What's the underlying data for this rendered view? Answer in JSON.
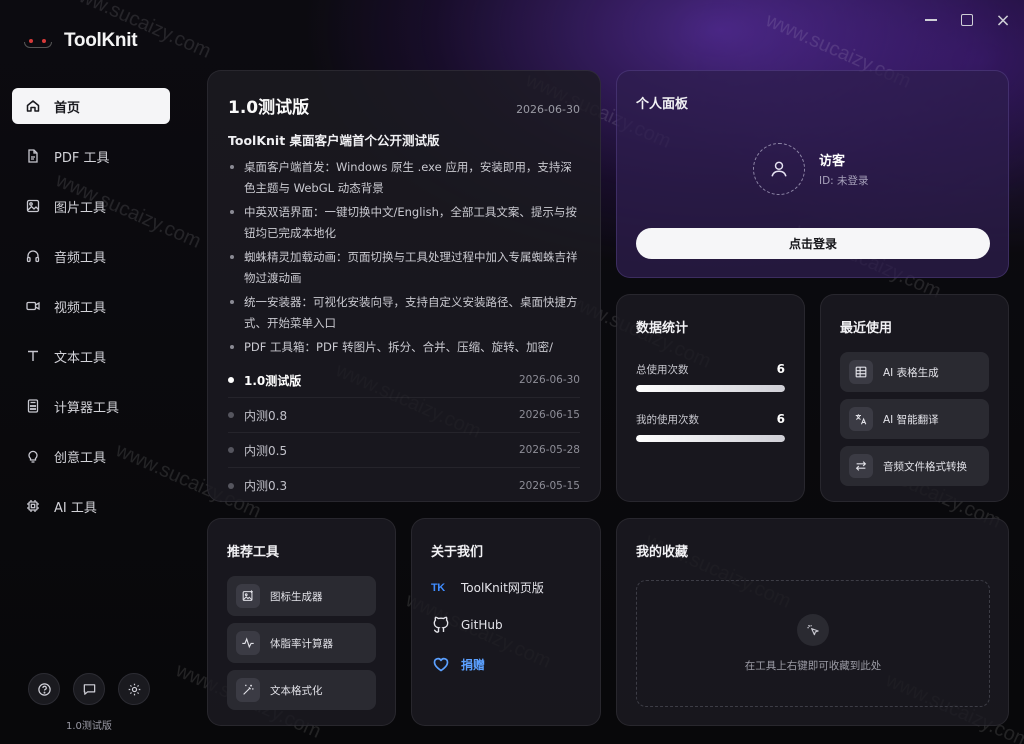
{
  "app": {
    "name": "ToolKnit"
  },
  "window_controls": {
    "minimize": "minimize",
    "maximize": "maximize",
    "close": "×"
  },
  "sidebar": {
    "items": [
      {
        "label": "首页",
        "icon": "home-icon",
        "active": true
      },
      {
        "label": "PDF 工具",
        "icon": "pdf-icon"
      },
      {
        "label": "图片工具",
        "icon": "image-icon"
      },
      {
        "label": "音频工具",
        "icon": "headphones-icon"
      },
      {
        "label": "视频工具",
        "icon": "video-icon"
      },
      {
        "label": "文本工具",
        "icon": "text-icon"
      },
      {
        "label": "计算器工具",
        "icon": "calculator-icon"
      },
      {
        "label": "创意工具",
        "icon": "lightbulb-icon"
      },
      {
        "label": "AI 工具",
        "icon": "chip-icon"
      }
    ],
    "footer_version": "1.0测试版"
  },
  "release": {
    "title": "1.0测试版",
    "date": "2026-06-30",
    "subtitle": "ToolKnit 桌面客户端首个公开测试版",
    "notes": [
      "桌面客户端首发：Windows 原生 .exe 应用，安装即用，支持深色主题与 WebGL 动态背景",
      "中英双语界面：一键切换中文/English，全部工具文案、提示与按钮均已完成本地化",
      "蜘蛛精灵加载动画：页面切换与工具处理过程中加入专属蜘蛛吉祥物过渡动画",
      "统一安装器：可视化安装向导，支持自定义安装路径、桌面快捷方式、开始菜单入口",
      "PDF 工具箱：PDF 转图片、拆分、合并、压缩、旋转、加密/"
    ],
    "versions": [
      {
        "name": "1.0测试版",
        "date": "2026-06-30",
        "current": true
      },
      {
        "name": "内测0.8",
        "date": "2026-06-15"
      },
      {
        "name": "内测0.5",
        "date": "2026-05-28"
      },
      {
        "name": "内测0.3",
        "date": "2026-05-15"
      }
    ]
  },
  "profile": {
    "title": "个人面板",
    "user_name": "访客",
    "user_id": "ID: 未登录",
    "login_label": "点击登录"
  },
  "stats": {
    "title": "数据统计",
    "items": [
      {
        "label": "总使用次数",
        "value": "6",
        "fill": 1.0
      },
      {
        "label": "我的使用次数",
        "value": "6",
        "fill": 1.0
      }
    ]
  },
  "recent": {
    "title": "最近使用",
    "items": [
      {
        "label": "AI 表格生成",
        "icon": "table-icon"
      },
      {
        "label": "AI 智能翻译",
        "icon": "translate-icon"
      },
      {
        "label": "音频文件格式转换",
        "icon": "swap-icon"
      }
    ]
  },
  "recommend": {
    "title": "推荐工具",
    "items": [
      {
        "label": "图标生成器",
        "icon": "image-plus-icon"
      },
      {
        "label": "体脂率计算器",
        "icon": "pulse-icon"
      },
      {
        "label": "文本格式化",
        "icon": "magic-wand-icon"
      }
    ]
  },
  "about": {
    "title": "关于我们",
    "links": [
      {
        "label": "ToolKnit网页版",
        "icon": "tk-logo-icon",
        "badge": "TK"
      },
      {
        "label": "GitHub",
        "icon": "github-icon"
      },
      {
        "label": "捐赠",
        "icon": "heart-icon"
      }
    ]
  },
  "favorites": {
    "title": "我的收藏",
    "hint": "在工具上右键即可收藏到此处"
  },
  "watermark": "www.sucaizy.com",
  "colors": {
    "accent_purple": "#6a3cd0",
    "donate_blue": "#5ba0ff",
    "active_nav_bg": "#f5f5f7"
  }
}
